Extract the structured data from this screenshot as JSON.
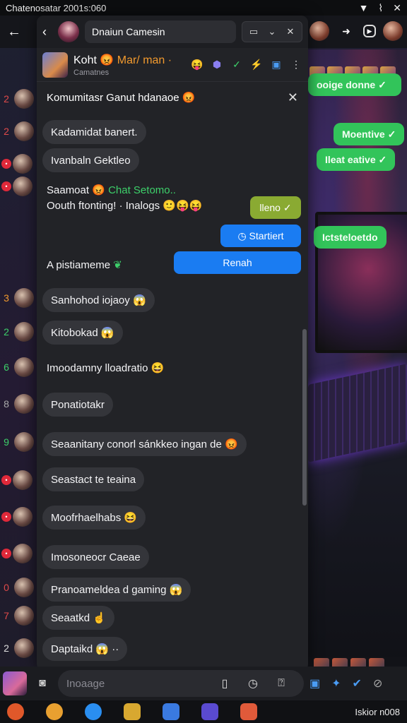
{
  "statusbar": {
    "title": "Chatenosatar 2001s:060",
    "icons": [
      "signal-icon",
      "wifi-icon",
      "close-icon"
    ]
  },
  "bg_header": {
    "back": "←"
  },
  "panel": {
    "search_value": "Dnaiun Camesin",
    "chat_title_pre": "Koht",
    "chat_title_orange": "Mar/ man ·",
    "chat_subtitle": "Camatnes",
    "notice": "Komumitasr Ganut hdanaoe",
    "messages": [
      {
        "text": "Kadamidat banert."
      },
      {
        "text": "Ivanbaln Gektleo"
      },
      {
        "text": "Sanhohod iojaoy"
      },
      {
        "text": "Kitobokad"
      },
      {
        "text": "Ponatiotakr"
      },
      {
        "text": "Seaanitany conorl sánkkeo ingan de"
      },
      {
        "text": "Seastact te teaina"
      },
      {
        "text": "Moofrhaelhabs"
      },
      {
        "text": "Imosoneocr Caeae"
      },
      {
        "text": "Pranoameldea d gaming"
      },
      {
        "text": "Seaatkd"
      },
      {
        "text": "Daptaikd"
      }
    ],
    "plain_lines": {
      "line1_a": "Saamoat",
      "line1_b": "Chat Setomo..",
      "line2": "Oouth ftonting! · Inalogs",
      "line3": "A pistiameme",
      "line4": "Imoodamny lloadratio"
    },
    "outgoing": [
      {
        "text": "lleno ✓"
      },
      {
        "text": "Startiert"
      },
      {
        "text": "Renah"
      }
    ]
  },
  "rail": [
    {
      "num": "2",
      "badge": ""
    },
    {
      "num": "2",
      "badge": ""
    },
    {
      "num": "",
      "badge": "•"
    },
    {
      "num": "",
      "badge": "•"
    },
    {
      "num": "3",
      "badge": ""
    },
    {
      "num": "2",
      "badge": ""
    },
    {
      "num": "6",
      "badge": ""
    },
    {
      "num": "8",
      "badge": ""
    },
    {
      "num": "9",
      "badge": ""
    },
    {
      "num": "",
      "badge": "•"
    },
    {
      "num": "",
      "badge": "•"
    },
    {
      "num": "",
      "badge": "•"
    },
    {
      "num": "0",
      "badge": ""
    },
    {
      "num": "7",
      "badge": ""
    },
    {
      "num": "2",
      "badge": ""
    }
  ],
  "right_bubbles": [
    {
      "text": "Moentive ✓"
    },
    {
      "text": "Ileat eative ✓"
    },
    {
      "text": "Ictsteloetdo"
    },
    {
      "text": "ooige   donne ✓"
    }
  ],
  "composer": {
    "placeholder": "Inoaage"
  },
  "taskbar": {
    "time": "Iskior n008"
  },
  "colors": {
    "accent_blue": "#1a7cf2",
    "green": "#32c45a",
    "olive": "#8aaa32",
    "orange": "#f29a2e"
  }
}
